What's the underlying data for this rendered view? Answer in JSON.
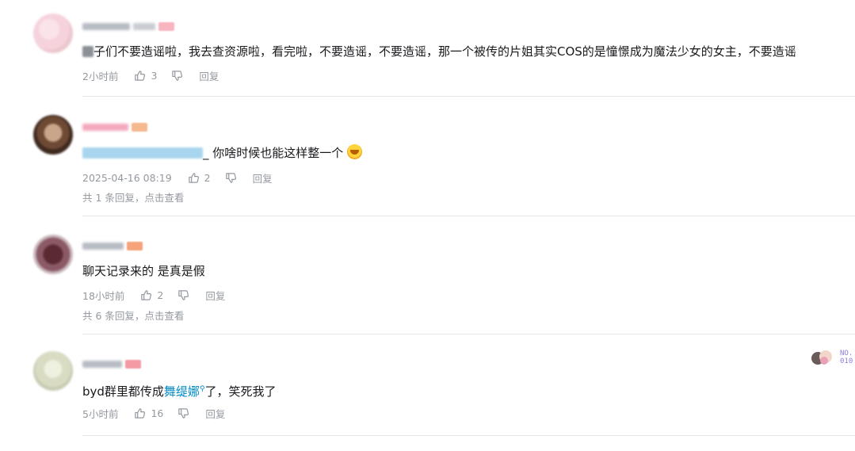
{
  "comments": [
    {
      "text_main": "子们不要造谣啦，我去查资源啦，看完啦，不要造谣，不要造谣，那一个被传的片姐其实COS的是憧憬成为魔法少女的女主，不要造谣",
      "time": "2小时前",
      "likes": "3",
      "reply_label": "回复"
    },
    {
      "text_main": "_ 你啥时候也能这样整一个",
      "time": "2025-04-16 08:19",
      "likes": "2",
      "reply_label": "回复",
      "sub_replies": "共 1 条回复，点击查看"
    },
    {
      "text_main": "聊天记录来的 是真是假",
      "time": "18小时前",
      "likes": "2",
      "reply_label": "回复",
      "sub_replies": "共 6 条回复，点击查看"
    },
    {
      "text_pre": "byd群里都传成",
      "keyword": "舞缇娜",
      "text_post": "了，笑死我了",
      "time": "5小时前",
      "likes": "16",
      "reply_label": "回复",
      "fan_badge_no": [
        "NO.",
        "010"
      ]
    }
  ],
  "icons": {
    "like": "thumbs-up-icon",
    "dislike": "thumbs-down-icon",
    "search": "search-icon"
  },
  "colors": {
    "keyword": "#008ac5",
    "meta": "#9499a0",
    "divider": "#e3e5e7"
  }
}
